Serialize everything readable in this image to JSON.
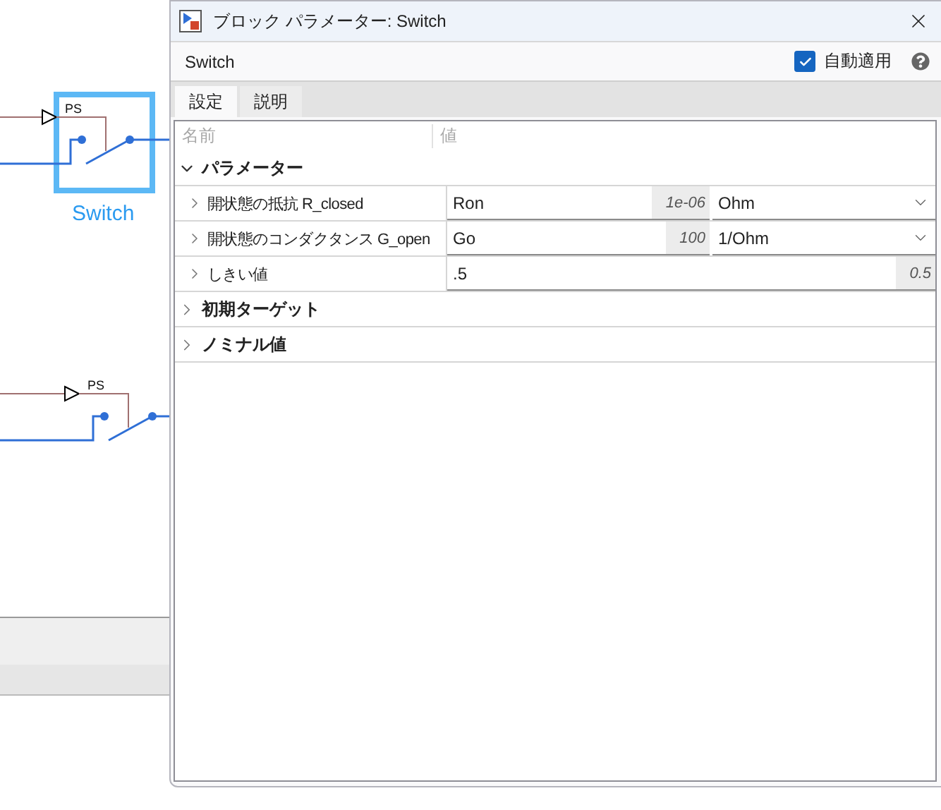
{
  "canvas": {
    "blocks": [
      {
        "kind": "switch",
        "port_label": "PS",
        "name": "Switch",
        "selected": true
      },
      {
        "kind": "switch",
        "port_label": "PS",
        "selected": false
      }
    ]
  },
  "window": {
    "title": "ブロック パラメーター: Switch"
  },
  "block_name": "Switch",
  "auto_apply": {
    "label": "自動適用",
    "checked": true
  },
  "tabs": [
    {
      "label": "設定",
      "selected": true
    },
    {
      "label": "説明",
      "selected": false
    }
  ],
  "table": {
    "columns": [
      "名前",
      "値"
    ],
    "groups": [
      {
        "label": "パラメーター",
        "expanded": true,
        "parameters": [
          {
            "name": "開状態の抵抗 R_closed",
            "expanded": false,
            "value": "Ron",
            "default": "1e-06",
            "unit": "Ohm"
          },
          {
            "name": "開状態のコンダクタンス G_open",
            "expanded": false,
            "value": "Go",
            "default": "100",
            "unit": "1/Ohm"
          },
          {
            "name": "しきい値",
            "expanded": false,
            "value": ".5",
            "default": "0.5"
          }
        ]
      },
      {
        "label": "初期ターゲット",
        "expanded": false
      },
      {
        "label": "ノミナル値",
        "expanded": false
      }
    ]
  }
}
